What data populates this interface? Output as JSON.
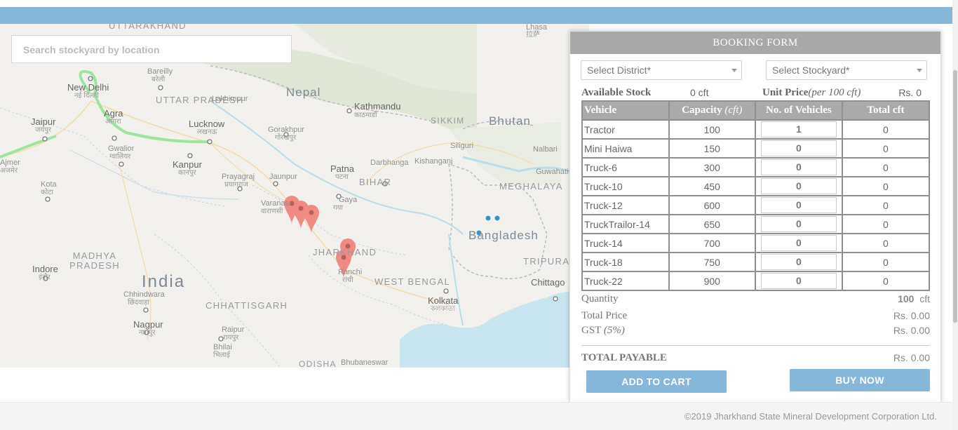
{
  "map": {
    "search_placeholder": "Search stockyard by location",
    "labels": {
      "uttarakhand": "UTTARAKHAND",
      "nepal": "Nepal",
      "bhutan": "Bhutan",
      "bangladesh": "Bangladesh",
      "india": "India",
      "uttar_pradesh": "UTTAR PRADESH",
      "bihar": "BIHAR",
      "jharkhand": "JHARKHAND",
      "west_bengal": "WEST BENGAL",
      "madhya_pradesh": "MADHYA PRADESH",
      "chhattisgarh": "CHHATTISGARH",
      "meghalaya": "MEGHALAYA",
      "tripura": "TRIPURA",
      "sikkim": "SIKKIM",
      "odisha": "ODISHA",
      "new_delhi": "New Delhi",
      "new_delhi_sub": "नई दिल्ली",
      "agra": "Agra",
      "agra_sub": "आगरा",
      "jaipur": "Jaipur",
      "jaipur_sub": "जयपुर",
      "lucknow": "Lucknow",
      "lucknow_sub": "लखनऊ",
      "kanpur": "Kanpur",
      "kanpur_sub": "कानपुर",
      "bareilly": "Bareilly",
      "bareilly_sub": "बरेली",
      "lakhimpur": "Lakhimpur",
      "gwalior": "Gwalior",
      "gwalior_sub": "ग्वालियर",
      "kota": "Kota",
      "kota_sub": "कोटा",
      "ajmer": "Ajmer",
      "ajmer_sub": "अजमेर",
      "prayagraj": "Prayagraj",
      "prayagraj_sub": "प्रयागराज",
      "jaunpur": "Jaunpur",
      "gorakhpur": "Gorakhpur",
      "gorakhpur_sub": "गोरखपुर",
      "varanasi": "Varanasi",
      "varanasi_sub": "वाराणसी",
      "kathmandu": "Kathmandu",
      "kathmandu_sub": "काठमाडौं",
      "patna": "Patna",
      "patna_sub": "पटना",
      "darbhanga": "Darbhanga",
      "kishanganj": "Kishanganj",
      "gaya": "Gaya",
      "gaya_sub": "गया",
      "siliguri": "Siliguri",
      "nalbari": "Nalbari",
      "guwahati": "Guwahati",
      "ranchi": "Ranchi",
      "ranchi_sub": "रांची",
      "kolkata": "Kolkata",
      "kolkata_sub": "কলকাতা",
      "indore": "Indore",
      "indore_sub": "इंदौर",
      "chhindwara": "Chhindwara",
      "chhindwara_sub": "छिंदवाड़ा",
      "nagpur": "Nagpur",
      "nagpur_sub": "नागपुर",
      "raipur": "Raipur",
      "raipur_sub": "रायपुर",
      "bhilai": "Bhilai",
      "bhilai_sub": "भिलाई",
      "bhubaneswar": "Bhubaneswar",
      "chittagong": "Chittago",
      "lhasa": "Lhasa",
      "lhasa_sub": "拉萨"
    }
  },
  "booking": {
    "title": "BOOKING FORM",
    "district_placeholder": "Select District*",
    "stockyard_placeholder": "Select Stockyard*",
    "available_stock_label": "Available Stock",
    "available_stock_value": "0 cft",
    "unit_price_label": "Unit Price",
    "unit_price_unit": "(per 100 cft)",
    "unit_price_value": "Rs. 0",
    "table": {
      "headers": {
        "vehicle": "Vehicle",
        "capacity": "Capacity",
        "capacity_unit": "(cft)",
        "vehicles": "No. of Vehicles",
        "total": "Total cft"
      },
      "rows": [
        {
          "vehicle": "Tractor",
          "capacity": "100",
          "count": "1",
          "total": "0"
        },
        {
          "vehicle": "Mini Haiwa",
          "capacity": "150",
          "count": "0",
          "total": "0"
        },
        {
          "vehicle": "Truck-6",
          "capacity": "300",
          "count": "0",
          "total": "0"
        },
        {
          "vehicle": "Truck-10",
          "capacity": "450",
          "count": "0",
          "total": "0"
        },
        {
          "vehicle": "Truck-12",
          "capacity": "600",
          "count": "0",
          "total": "0"
        },
        {
          "vehicle": "TruckTrailor-14",
          "capacity": "650",
          "count": "0",
          "total": "0"
        },
        {
          "vehicle": "Truck-14",
          "capacity": "700",
          "count": "0",
          "total": "0"
        },
        {
          "vehicle": "Truck-18",
          "capacity": "750",
          "count": "0",
          "total": "0"
        },
        {
          "vehicle": "Truck-22",
          "capacity": "900",
          "count": "0",
          "total": "0"
        }
      ]
    },
    "quantity_label": "Quantity",
    "quantity_value": "100",
    "quantity_unit": "cft",
    "total_price_label": "Total Price",
    "total_price_value": "Rs. 0.00",
    "gst_label": "GST",
    "gst_rate": "(5%)",
    "gst_value": "Rs. 0.00",
    "total_payable_label": "TOTAL PAYABLE",
    "total_payable_value": "Rs. 0.00",
    "add_to_cart": "ADD TO CART",
    "buy_now": "BUY NOW"
  },
  "footer": {
    "copyright": "©2019 Jharkhand State Mineral Development Corporation Ltd."
  },
  "colors": {
    "accent": "#85b7da",
    "header_gray": "#a8a8a8",
    "marker": "#f08b84",
    "dot": "#3e8ec9"
  }
}
